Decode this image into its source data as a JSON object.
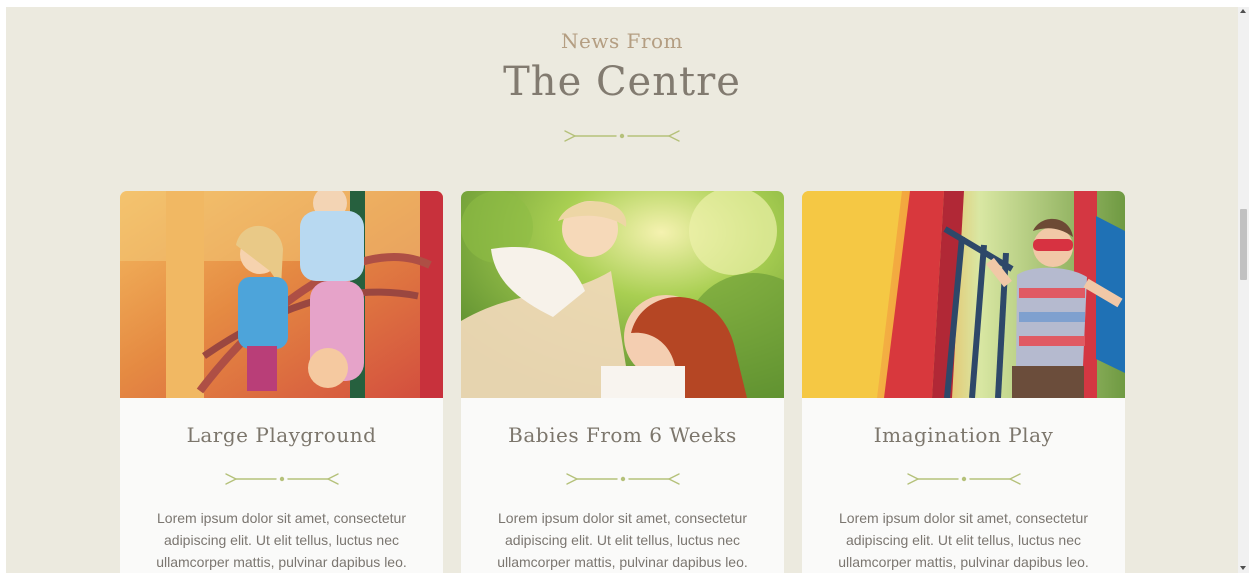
{
  "section": {
    "eyebrow": "News From",
    "title": "The Centre"
  },
  "cards": [
    {
      "title": "Large Playground",
      "text": "Lorem ipsum dolor sit amet, consectetur adipiscing elit. Ut elit tellus, luctus nec ullamcorper mattis, pulvinar dapibus leo.",
      "image": "children-climbing-playground-photo"
    },
    {
      "title": "Babies From 6 Weeks",
      "text": "Lorem ipsum dolor sit amet, consectetur adipiscing elit. Ut elit tellus, luctus nec ullamcorper mattis, pulvinar dapibus leo.",
      "image": "mother-lifting-baby-photo"
    },
    {
      "title": "Imagination Play",
      "text": "Lorem ipsum dolor sit amet, consectetur adipiscing elit. Ut elit tellus, luctus nec ullamcorper mattis, pulvinar dapibus leo.",
      "image": "boy-superhero-playground-photo"
    }
  ],
  "colors": {
    "background": "#eceadf",
    "card": "#fafaf9",
    "eyebrow": "#b49e82",
    "heading": "#827b70",
    "divider": "#b5c17a",
    "body_text": "#7b7670"
  },
  "icons": {
    "section_divider": "leaf-divider-icon",
    "card_divider": "leaf-divider-icon"
  }
}
